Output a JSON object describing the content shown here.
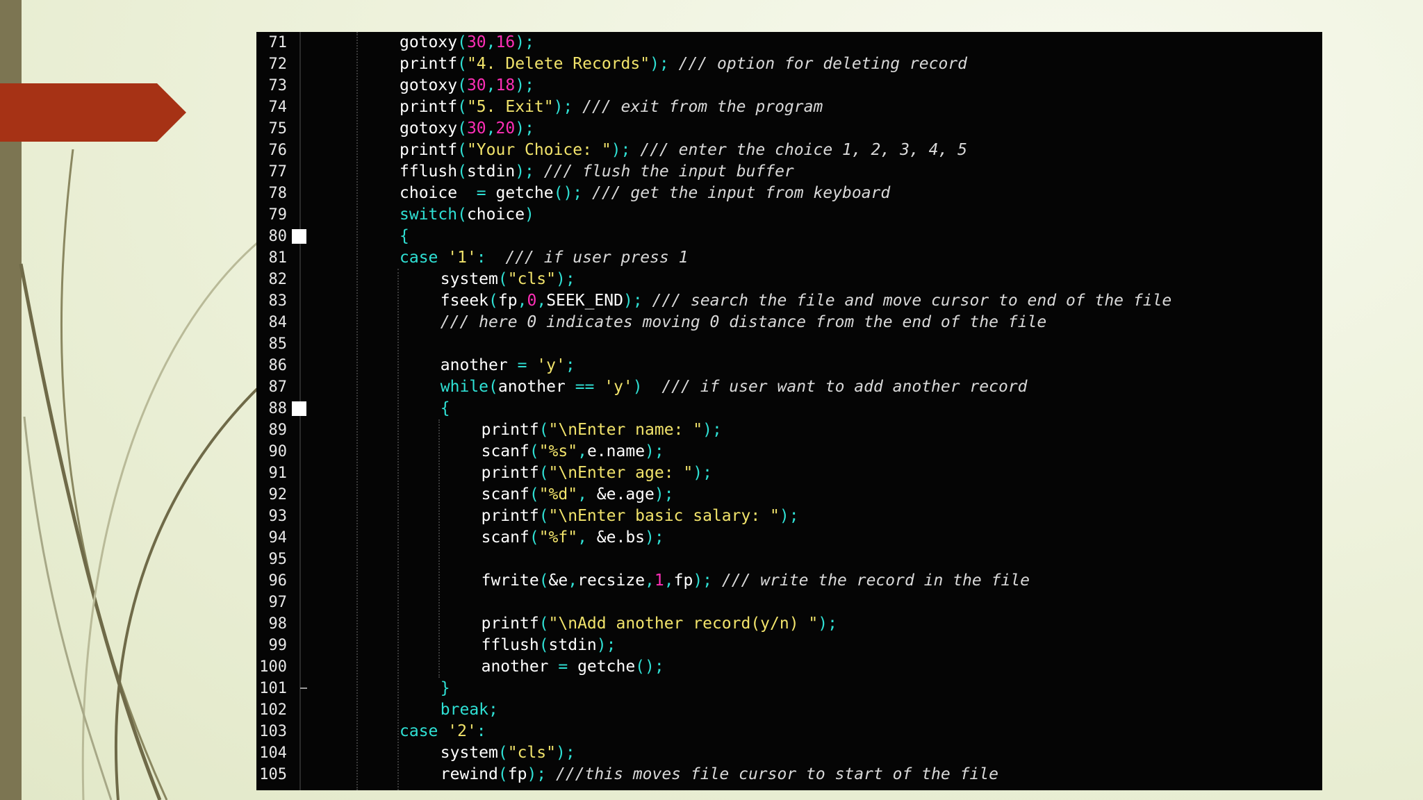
{
  "lines": [
    {
      "n": "71",
      "indent": 0,
      "tokens": [
        {
          "t": "gotoxy"
        },
        {
          "t": "(",
          "c": "p"
        },
        {
          "t": "30",
          "c": "n"
        },
        {
          "t": ",",
          "c": "p"
        },
        {
          "t": "16",
          "c": "n"
        },
        {
          "t": ");",
          "c": "p"
        }
      ]
    },
    {
      "n": "72",
      "indent": 0,
      "tokens": [
        {
          "t": "printf"
        },
        {
          "t": "(",
          "c": "p"
        },
        {
          "t": "\"4. Delete Records\"",
          "c": "s"
        },
        {
          "t": "); ",
          "c": "p"
        },
        {
          "t": "/// option for deleting record",
          "c": "c"
        }
      ]
    },
    {
      "n": "73",
      "indent": 0,
      "tokens": [
        {
          "t": "gotoxy"
        },
        {
          "t": "(",
          "c": "p"
        },
        {
          "t": "30",
          "c": "n"
        },
        {
          "t": ",",
          "c": "p"
        },
        {
          "t": "18",
          "c": "n"
        },
        {
          "t": ");",
          "c": "p"
        }
      ]
    },
    {
      "n": "74",
      "indent": 0,
      "tokens": [
        {
          "t": "printf"
        },
        {
          "t": "(",
          "c": "p"
        },
        {
          "t": "\"5. Exit\"",
          "c": "s"
        },
        {
          "t": "); ",
          "c": "p"
        },
        {
          "t": "/// exit from the program",
          "c": "c"
        }
      ]
    },
    {
      "n": "75",
      "indent": 0,
      "tokens": [
        {
          "t": "gotoxy"
        },
        {
          "t": "(",
          "c": "p"
        },
        {
          "t": "30",
          "c": "n"
        },
        {
          "t": ",",
          "c": "p"
        },
        {
          "t": "20",
          "c": "n"
        },
        {
          "t": ");",
          "c": "p"
        }
      ]
    },
    {
      "n": "76",
      "indent": 0,
      "tokens": [
        {
          "t": "printf"
        },
        {
          "t": "(",
          "c": "p"
        },
        {
          "t": "\"Your Choice: \"",
          "c": "s"
        },
        {
          "t": "); ",
          "c": "p"
        },
        {
          "t": "/// enter the choice 1, 2, 3, 4, 5",
          "c": "c"
        }
      ]
    },
    {
      "n": "77",
      "indent": 0,
      "tokens": [
        {
          "t": "fflush"
        },
        {
          "t": "(",
          "c": "p"
        },
        {
          "t": "stdin"
        },
        {
          "t": "); ",
          "c": "p"
        },
        {
          "t": "/// flush the input buffer",
          "c": "c"
        }
      ]
    },
    {
      "n": "78",
      "indent": 0,
      "tokens": [
        {
          "t": "choice  "
        },
        {
          "t": "= ",
          "c": "p"
        },
        {
          "t": "getche"
        },
        {
          "t": "(); ",
          "c": "p"
        },
        {
          "t": "/// get the input from keyboard",
          "c": "c"
        }
      ]
    },
    {
      "n": "79",
      "indent": 0,
      "tokens": [
        {
          "t": "switch",
          "c": "k"
        },
        {
          "t": "(",
          "c": "p"
        },
        {
          "t": "choice"
        },
        {
          "t": ")",
          "c": "p"
        }
      ]
    },
    {
      "n": "80",
      "indent": 0,
      "fold": "start",
      "tokens": [
        {
          "t": "{",
          "c": "p"
        }
      ]
    },
    {
      "n": "81",
      "indent": 0,
      "tokens": [
        {
          "t": "case ",
          "c": "k"
        },
        {
          "t": "'1'",
          "c": "s"
        },
        {
          "t": ":  ",
          "c": "p"
        },
        {
          "t": "/// if user press 1",
          "c": "c"
        }
      ]
    },
    {
      "n": "82",
      "indent": 1,
      "tokens": [
        {
          "t": "system"
        },
        {
          "t": "(",
          "c": "p"
        },
        {
          "t": "\"cls\"",
          "c": "s"
        },
        {
          "t": ");",
          "c": "p"
        }
      ]
    },
    {
      "n": "83",
      "indent": 1,
      "tokens": [
        {
          "t": "fseek"
        },
        {
          "t": "(",
          "c": "p"
        },
        {
          "t": "fp"
        },
        {
          "t": ",",
          "c": "p"
        },
        {
          "t": "0",
          "c": "n"
        },
        {
          "t": ",",
          "c": "p"
        },
        {
          "t": "SEEK_END"
        },
        {
          "t": "); ",
          "c": "p"
        },
        {
          "t": "/// search the file and move cursor to end of the file",
          "c": "c"
        }
      ]
    },
    {
      "n": "84",
      "indent": 1,
      "tokens": [
        {
          "t": "/// here 0 indicates moving 0 distance from the end of the file",
          "c": "c"
        }
      ]
    },
    {
      "n": "85",
      "indent": 1,
      "tokens": []
    },
    {
      "n": "86",
      "indent": 1,
      "tokens": [
        {
          "t": "another "
        },
        {
          "t": "= ",
          "c": "p"
        },
        {
          "t": "'y'",
          "c": "s"
        },
        {
          "t": ";",
          "c": "p"
        }
      ]
    },
    {
      "n": "87",
      "indent": 1,
      "tokens": [
        {
          "t": "while",
          "c": "k"
        },
        {
          "t": "(",
          "c": "p"
        },
        {
          "t": "another "
        },
        {
          "t": "== ",
          "c": "p"
        },
        {
          "t": "'y'",
          "c": "s"
        },
        {
          "t": ")  ",
          "c": "p"
        },
        {
          "t": "/// if user want to add another record",
          "c": "c"
        }
      ]
    },
    {
      "n": "88",
      "indent": 1,
      "fold": "start",
      "tokens": [
        {
          "t": "{",
          "c": "p"
        }
      ]
    },
    {
      "n": "89",
      "indent": 2,
      "tokens": [
        {
          "t": "printf"
        },
        {
          "t": "(",
          "c": "p"
        },
        {
          "t": "\"\\nEnter name: \"",
          "c": "s"
        },
        {
          "t": ");",
          "c": "p"
        }
      ]
    },
    {
      "n": "90",
      "indent": 2,
      "tokens": [
        {
          "t": "scanf"
        },
        {
          "t": "(",
          "c": "p"
        },
        {
          "t": "\"%s\"",
          "c": "s"
        },
        {
          "t": ",",
          "c": "p"
        },
        {
          "t": "e.name"
        },
        {
          "t": ");",
          "c": "p"
        }
      ]
    },
    {
      "n": "91",
      "indent": 2,
      "tokens": [
        {
          "t": "printf"
        },
        {
          "t": "(",
          "c": "p"
        },
        {
          "t": "\"\\nEnter age: \"",
          "c": "s"
        },
        {
          "t": ");",
          "c": "p"
        }
      ]
    },
    {
      "n": "92",
      "indent": 2,
      "tokens": [
        {
          "t": "scanf"
        },
        {
          "t": "(",
          "c": "p"
        },
        {
          "t": "\"%d\"",
          "c": "s"
        },
        {
          "t": ", ",
          "c": "p"
        },
        {
          "t": "&e.age"
        },
        {
          "t": ");",
          "c": "p"
        }
      ]
    },
    {
      "n": "93",
      "indent": 2,
      "tokens": [
        {
          "t": "printf"
        },
        {
          "t": "(",
          "c": "p"
        },
        {
          "t": "\"\\nEnter basic salary: \"",
          "c": "s"
        },
        {
          "t": ");",
          "c": "p"
        }
      ]
    },
    {
      "n": "94",
      "indent": 2,
      "tokens": [
        {
          "t": "scanf"
        },
        {
          "t": "(",
          "c": "p"
        },
        {
          "t": "\"%f\"",
          "c": "s"
        },
        {
          "t": ", ",
          "c": "p"
        },
        {
          "t": "&e.bs"
        },
        {
          "t": ");",
          "c": "p"
        }
      ]
    },
    {
      "n": "95",
      "indent": 2,
      "tokens": []
    },
    {
      "n": "96",
      "indent": 2,
      "tokens": [
        {
          "t": "fwrite"
        },
        {
          "t": "(",
          "c": "p"
        },
        {
          "t": "&e"
        },
        {
          "t": ",",
          "c": "p"
        },
        {
          "t": "recsize"
        },
        {
          "t": ",",
          "c": "p"
        },
        {
          "t": "1",
          "c": "n"
        },
        {
          "t": ",",
          "c": "p"
        },
        {
          "t": "fp"
        },
        {
          "t": "); ",
          "c": "p"
        },
        {
          "t": "/// write the record in the file",
          "c": "c"
        }
      ]
    },
    {
      "n": "97",
      "indent": 2,
      "tokens": []
    },
    {
      "n": "98",
      "indent": 2,
      "tokens": [
        {
          "t": "printf"
        },
        {
          "t": "(",
          "c": "p"
        },
        {
          "t": "\"\\nAdd another record(y/n) \"",
          "c": "s"
        },
        {
          "t": ");",
          "c": "p"
        }
      ]
    },
    {
      "n": "99",
      "indent": 2,
      "tokens": [
        {
          "t": "fflush"
        },
        {
          "t": "(",
          "c": "p"
        },
        {
          "t": "stdin"
        },
        {
          "t": ");",
          "c": "p"
        }
      ]
    },
    {
      "n": "100",
      "indent": 2,
      "tokens": [
        {
          "t": "another "
        },
        {
          "t": "= ",
          "c": "p"
        },
        {
          "t": "getche"
        },
        {
          "t": "();",
          "c": "p"
        }
      ]
    },
    {
      "n": "101",
      "indent": 1,
      "fold": "end",
      "tokens": [
        {
          "t": "}",
          "c": "p"
        }
      ]
    },
    {
      "n": "102",
      "indent": 1,
      "tokens": [
        {
          "t": "break",
          "c": "k"
        },
        {
          "t": ";",
          "c": "p"
        }
      ]
    },
    {
      "n": "103",
      "indent": 0,
      "tokens": [
        {
          "t": "case ",
          "c": "k"
        },
        {
          "t": "'2'",
          "c": "s"
        },
        {
          "t": ":",
          "c": "p"
        }
      ]
    },
    {
      "n": "104",
      "indent": 1,
      "tokens": [
        {
          "t": "system"
        },
        {
          "t": "(",
          "c": "p"
        },
        {
          "t": "\"cls\"",
          "c": "s"
        },
        {
          "t": ");",
          "c": "p"
        }
      ]
    },
    {
      "n": "105",
      "indent": 1,
      "tokens": [
        {
          "t": "rewind"
        },
        {
          "t": "(",
          "c": "p"
        },
        {
          "t": "fp"
        },
        {
          "t": "); ",
          "c": "p"
        },
        {
          "t": "///this moves file cursor to start of the file",
          "c": "c"
        }
      ]
    }
  ],
  "colors": {
    "string": "#f1e36b",
    "number": "#ff2fb7",
    "keyword": "#2fe0d4",
    "comment": "#d9d9d9",
    "text": "#ffffff",
    "arrow": "#a63215",
    "panel": "#050505"
  }
}
